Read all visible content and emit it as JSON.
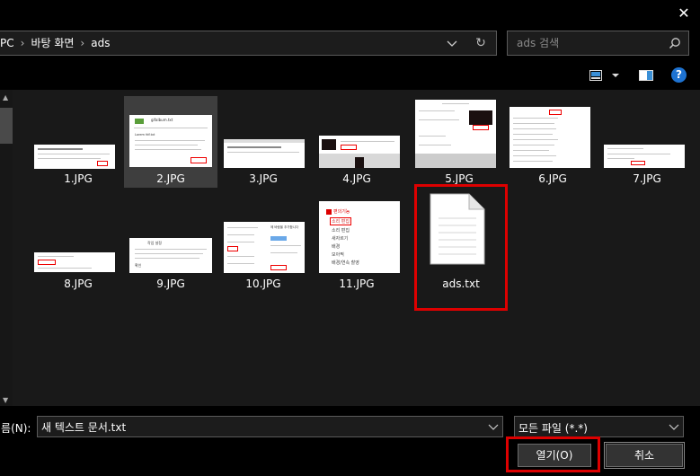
{
  "window": {
    "close_glyph": "✕"
  },
  "address": {
    "crumbs": [
      "PC",
      "바탕 화면",
      "ads"
    ],
    "separator": "›",
    "refresh_glyph": "↻"
  },
  "search": {
    "placeholder": "ads 검색"
  },
  "toolbar": {
    "help_glyph": "?"
  },
  "files": [
    {
      "name": "1.JPG",
      "selected": false,
      "outlined": false,
      "kind": "image"
    },
    {
      "name": "2.JPG",
      "selected": true,
      "outlined": false,
      "kind": "image"
    },
    {
      "name": "3.JPG",
      "selected": false,
      "outlined": false,
      "kind": "image"
    },
    {
      "name": "4.JPG",
      "selected": false,
      "outlined": false,
      "kind": "image"
    },
    {
      "name": "5.JPG",
      "selected": false,
      "outlined": false,
      "kind": "image"
    },
    {
      "name": "6.JPG",
      "selected": false,
      "outlined": false,
      "kind": "image"
    },
    {
      "name": "7.JPG",
      "selected": false,
      "outlined": false,
      "kind": "image"
    },
    {
      "name": "8.JPG",
      "selected": false,
      "outlined": false,
      "kind": "image"
    },
    {
      "name": "9.JPG",
      "selected": false,
      "outlined": false,
      "kind": "image"
    },
    {
      "name": "10.JPG",
      "selected": false,
      "outlined": false,
      "kind": "image"
    },
    {
      "name": "11.JPG",
      "selected": false,
      "outlined": false,
      "kind": "image"
    },
    {
      "name": "ads.txt",
      "selected": false,
      "outlined": true,
      "kind": "text-document"
    }
  ],
  "thumb_text": {
    "t2": [
      "gifalbum.txt",
      "C:\\fdaf\\sl",
      "Lorem fdf.txt"
    ],
    "t11": [
      "편의기능",
      "소리 편집",
      "소리 편집",
      "새자르기",
      "배경",
      "모아찍",
      "배경/연속 촬영"
    ],
    "t9": [
      "작업 설정",
      "확인"
    ],
    "t10": [
      "에 바람을 추가합니다"
    ]
  },
  "filename": {
    "label": "이름(N):",
    "value": "새 텍스트 문서.txt"
  },
  "filetype": {
    "value": "모든 파일 (*.*)"
  },
  "buttons": {
    "open": "열기(O)",
    "cancel": "취소"
  },
  "colors": {
    "highlight_red": "#dd0000",
    "selected_bg": "#3e3e3e",
    "help_blue": "#1e73d2"
  }
}
